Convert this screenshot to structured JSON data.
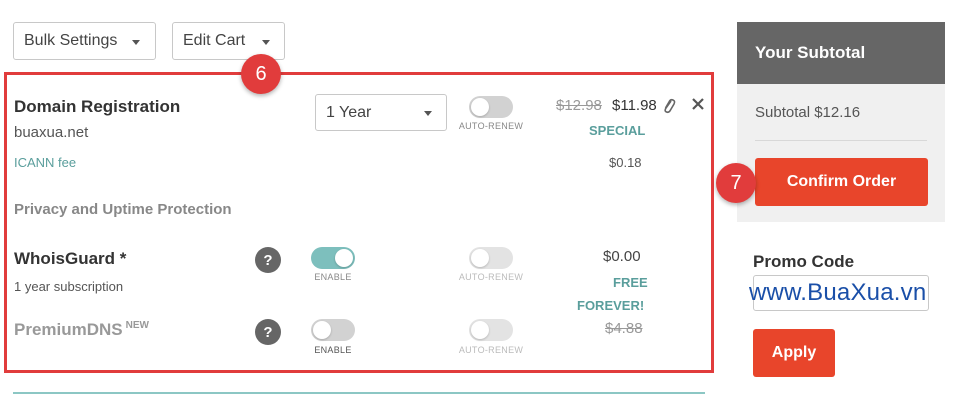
{
  "toolbar": {
    "bulk_settings_label": "Bulk Settings",
    "edit_cart_label": "Edit Cart"
  },
  "annotations": {
    "badge_cart": "6",
    "badge_confirm": "7"
  },
  "cart": {
    "domain": {
      "title": "Domain Registration",
      "name": "buaxua.net",
      "period_value": "1 Year",
      "auto_renew_label": "AUTO-RENEW",
      "old_price": "$12.98",
      "new_price": "$11.98",
      "special_label": "SPECIAL",
      "icann_label": "ICANN fee",
      "icann_price": "$0.18"
    },
    "section_title": "Privacy and Uptime Protection",
    "whoisguard": {
      "title": "WhoisGuard *",
      "subtitle": "1 year subscription",
      "help": "?",
      "enable_label": "ENABLE",
      "auto_renew_label": "AUTO-RENEW",
      "price": "$0.00",
      "free_label": "FREE",
      "forever_label": "FOREVER!"
    },
    "premiumdns": {
      "title": "PremiumDNS",
      "new_tag": "NEW",
      "help": "?",
      "enable_label": "ENABLE",
      "auto_renew_label": "AUTO-RENEW",
      "price": "$4.88"
    }
  },
  "subtotal": {
    "header": "Your Subtotal",
    "text": "Subtotal $12.16",
    "confirm_label": "Confirm Order"
  },
  "promo": {
    "label": "Promo Code",
    "input_value": "",
    "apply_label": "Apply"
  },
  "watermark": "www.BuaXua.vn",
  "colors": {
    "accent_red": "#e8452b",
    "teal": "#5a9e9c",
    "header_gray": "#666666",
    "annotation_red": "#e13c3c"
  }
}
